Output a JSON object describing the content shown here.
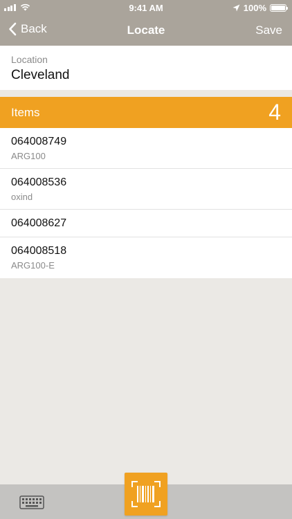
{
  "status_bar": {
    "time": "9:41 AM",
    "battery": "100%"
  },
  "nav": {
    "back_label": "Back",
    "title": "Locate",
    "save_label": "Save"
  },
  "location": {
    "label": "Location",
    "value": "Cleveland"
  },
  "items": {
    "label": "Items",
    "count": "4",
    "list": [
      {
        "code": "064008749",
        "sub": "ARG100"
      },
      {
        "code": "064008536",
        "sub": "oxind"
      },
      {
        "code": "064008627",
        "sub": ""
      },
      {
        "code": "064008518",
        "sub": "ARG100-E"
      }
    ]
  },
  "colors": {
    "header_bg": "#aaa49b",
    "accent": "#f0a121",
    "background": "#ebe9e5",
    "bottom_bar": "#c4c3c1"
  },
  "icons": {
    "back": "chevron-left-icon",
    "keyboard": "keyboard-icon",
    "scan": "barcode-scan-icon"
  }
}
